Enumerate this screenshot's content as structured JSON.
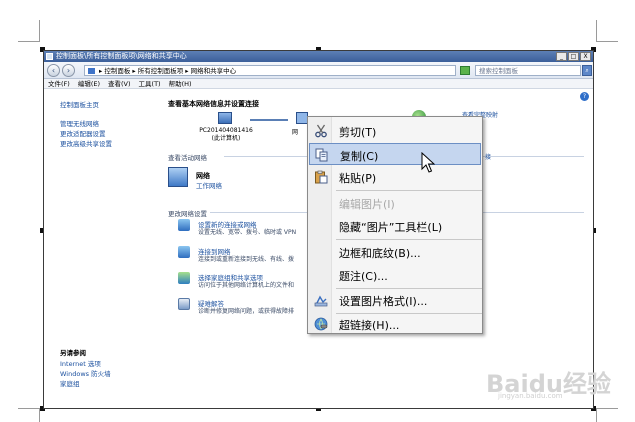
{
  "window": {
    "title": "控制面板\\所有控制面板项\\网络和共享中心",
    "controls": {
      "minimize": "_",
      "maximize": "□",
      "close": "X"
    }
  },
  "address": {
    "path": "▸ 控制面板 ▸ 所有控制面板项 ▸ 网络和共享中心",
    "search_placeholder": "搜索控制面板"
  },
  "menu": [
    "文件(F)",
    "编辑(E)",
    "查看(V)",
    "工具(T)",
    "帮助(H)"
  ],
  "sidebar": {
    "home": "控制面板主页",
    "links": [
      "管理无线网络",
      "更改适配器设置",
      "更改高级共享设置"
    ],
    "see_also_title": "另请参阅",
    "see_also": [
      "Internet 选项",
      "Windows 防火墙",
      "家庭组"
    ]
  },
  "main": {
    "title": "查看基本网络信息并设置连接",
    "full_map": "查看完整映射",
    "computer_name": "PC201404081416",
    "computer_sub": "(此计算机)",
    "second_node": "网",
    "active_title": "查看活动网络",
    "network_name": "网络",
    "network_type": "工作网络",
    "change_title": "更改网络设置",
    "right_link": "接",
    "tasks": [
      {
        "title": "设置新的连接或网络",
        "desc": "设置无线、宽带、拨号、临时或 VPN"
      },
      {
        "title": "连接到网络",
        "desc": "连接到或重新连接到无线、有线、拨"
      },
      {
        "title": "选择家庭组和共享选项",
        "desc": "访问位于其他网络计算机上的文件和"
      },
      {
        "title": "疑难解答",
        "desc": "诊断并修复网络问题，或获得故障排"
      }
    ]
  },
  "context_menu": {
    "items": [
      {
        "label": "剪切(T)",
        "icon": "scissors-icon",
        "disabled": false,
        "highlighted": false
      },
      {
        "label": "复制(C)",
        "icon": "copy-icon",
        "disabled": false,
        "highlighted": true
      },
      {
        "label": "粘贴(P)",
        "icon": "paste-icon",
        "disabled": false,
        "highlighted": false
      },
      {
        "label": "编辑图片(I)",
        "icon": "",
        "disabled": true,
        "highlighted": false
      },
      {
        "label": "隐藏“图片”工具栏(L)",
        "icon": "",
        "disabled": false,
        "highlighted": false
      },
      {
        "label": "边框和底纹(B)...",
        "icon": "",
        "disabled": false,
        "highlighted": false
      },
      {
        "label": "题注(C)...",
        "icon": "",
        "disabled": false,
        "highlighted": false
      },
      {
        "label": "设置图片格式(I)...",
        "icon": "format-picture-icon",
        "disabled": false,
        "highlighted": false
      },
      {
        "label": "超链接(H)...",
        "icon": "hyperlink-icon",
        "disabled": false,
        "highlighted": false
      }
    ]
  },
  "watermark": {
    "brand": "Baidu经验",
    "url": "jingyan.baidu.com"
  },
  "colors": {
    "link": "#1a4f9e",
    "titlebar": "#3b5f9a",
    "highlight": "#c5d6ef"
  }
}
